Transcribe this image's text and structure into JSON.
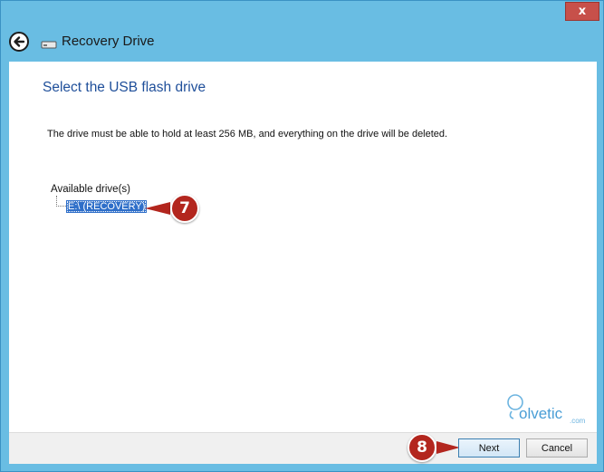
{
  "window": {
    "title": "Recovery Drive",
    "close_label": "x"
  },
  "page": {
    "heading": "Select the USB flash drive",
    "description": "The drive must be able to hold at least 256 MB, and everything on the drive will be deleted.",
    "available_label": "Available drive(s)",
    "drives": [
      {
        "label": "E:\\ (RECOVERY)",
        "selected": true
      }
    ]
  },
  "callouts": [
    {
      "number": "7"
    },
    {
      "number": "8"
    }
  ],
  "logo": {
    "text": "olvetic",
    "suffix": ".com"
  },
  "buttons": {
    "next": "Next",
    "cancel": "Cancel"
  },
  "colors": {
    "window_frame": "#69bde3",
    "heading": "#1f4f9a",
    "selection": "#2f6fc9",
    "callout": "#b3261e"
  }
}
